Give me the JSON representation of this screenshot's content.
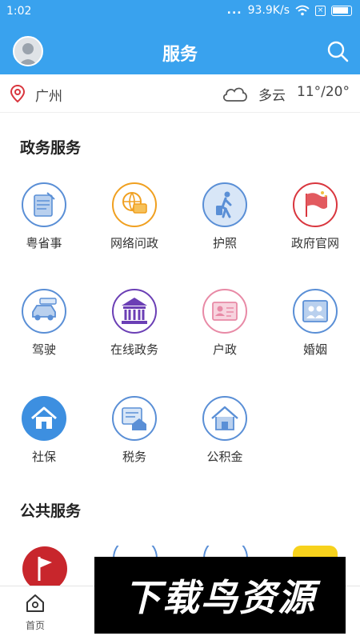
{
  "status_bar": {
    "time": "1:02",
    "network_speed": "93.9K/s",
    "dots": "..."
  },
  "header": {
    "title": "服务"
  },
  "location": {
    "city": "广州",
    "weather": "多云",
    "temperature": "11°/20°"
  },
  "sections": {
    "gov": {
      "title": "政务服务",
      "items": [
        {
          "label": "粤省事",
          "icon": "yue-icon",
          "color": "#5a8fd6"
        },
        {
          "label": "网络问政",
          "icon": "globe-chat-icon",
          "color": "#f0a020"
        },
        {
          "label": "护照",
          "icon": "traveler-icon",
          "color": "#5a8fd6"
        },
        {
          "label": "政府官网",
          "icon": "flag-icon",
          "color": "#d9363e"
        },
        {
          "label": "驾驶",
          "icon": "car-icon",
          "color": "#5a8fd6"
        },
        {
          "label": "在线政务",
          "icon": "building-icon",
          "color": "#6b3fb5"
        },
        {
          "label": "户政",
          "icon": "id-card-icon",
          "color": "#e88aa6"
        },
        {
          "label": "婚姻",
          "icon": "couple-icon",
          "color": "#5a8fd6"
        },
        {
          "label": "社保",
          "icon": "home-icon",
          "color": "#3d8fe0"
        },
        {
          "label": "税务",
          "icon": "tax-house-icon",
          "color": "#5a8fd6"
        },
        {
          "label": "公积金",
          "icon": "house-icon",
          "color": "#5a8fd6"
        }
      ]
    },
    "public": {
      "title": "公共服务"
    }
  },
  "tabbar": {
    "home_label": "首页"
  },
  "watermark": "下载鸟资源"
}
